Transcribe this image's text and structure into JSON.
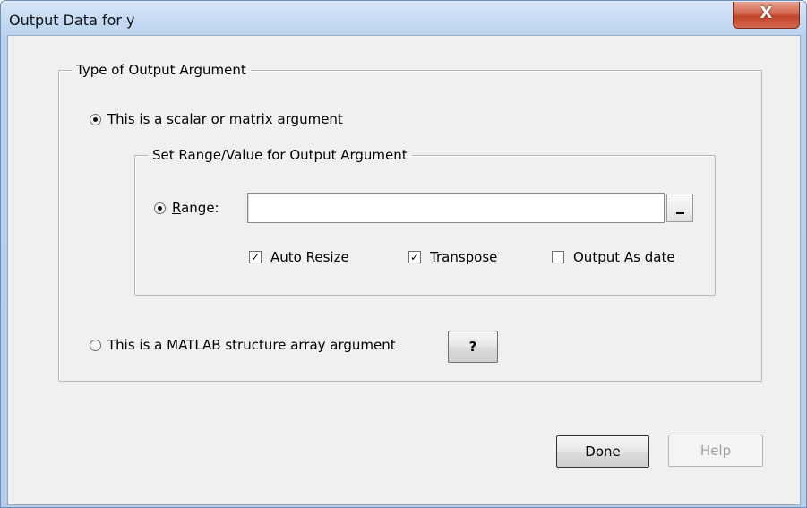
{
  "window": {
    "title": "Output Data for y",
    "close_glyph": "X"
  },
  "type_group": {
    "legend": "Type of Output Argument",
    "scalar_option": {
      "label": "This is a scalar or matrix argument",
      "selected": true
    },
    "structure_option": {
      "label": "This is a MATLAB structure array argument",
      "selected": false
    },
    "help_glyph": "?"
  },
  "range_group": {
    "legend": "Set Range/Value for Output Argument",
    "range_option": {
      "label_first": "R",
      "label_rest": "ange:",
      "selected": true
    },
    "range_value": "",
    "range_button_icon": "collapse-dialog-icon",
    "auto_resize": {
      "label_pre": "Auto ",
      "label_ul": "R",
      "label_post": "esize",
      "checked": true
    },
    "transpose": {
      "label_pre": "",
      "label_ul": "T",
      "label_post": "ranspose",
      "checked": true
    },
    "output_as_date": {
      "label_pre": "Output As ",
      "label_ul": "d",
      "label_post": "ate",
      "checked": false
    }
  },
  "buttons": {
    "done": "Done",
    "help": "Help"
  },
  "colors": {
    "title_bar": "#c6dbf3",
    "close_button": "#c2432a",
    "dialog_face": "#f0f0f0",
    "disabled_text": "#a0a0a0"
  }
}
